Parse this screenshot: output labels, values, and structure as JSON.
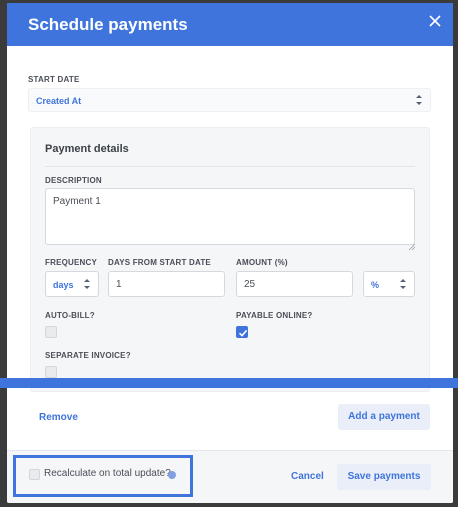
{
  "modal": {
    "title": "Schedule payments",
    "close_icon": "close-icon"
  },
  "start_date": {
    "label": "START DATE",
    "value": "Created At"
  },
  "payment_details": {
    "title": "Payment details",
    "description_label": "DESCRIPTION",
    "description_value": "Payment 1",
    "frequency_label": "FREQUENCY",
    "frequency_value": "days",
    "days_label": "DAYS FROM START DATE",
    "days_value": "1",
    "amount_label": "AMOUNT (%)",
    "amount_value": "25",
    "amount_unit": "%",
    "autobill_label": "AUTO-BILL?",
    "autobill_checked": false,
    "payable_label": "PAYABLE ONLINE?",
    "payable_checked": true,
    "separate_label": "SEPARATE INVOICE?",
    "separate_checked": false
  },
  "actions": {
    "remove_label": "Remove",
    "add_payment_label": "Add a payment"
  },
  "footer": {
    "recalc_label": "Recalculate on total update?",
    "recalc_checked": false,
    "info_icon": "info-icon",
    "cancel_label": "Cancel",
    "save_label": "Save payments"
  },
  "colors": {
    "accent": "#3f74dc",
    "backdrop": "#3b3b3b",
    "button_light": "#e9eef8"
  }
}
